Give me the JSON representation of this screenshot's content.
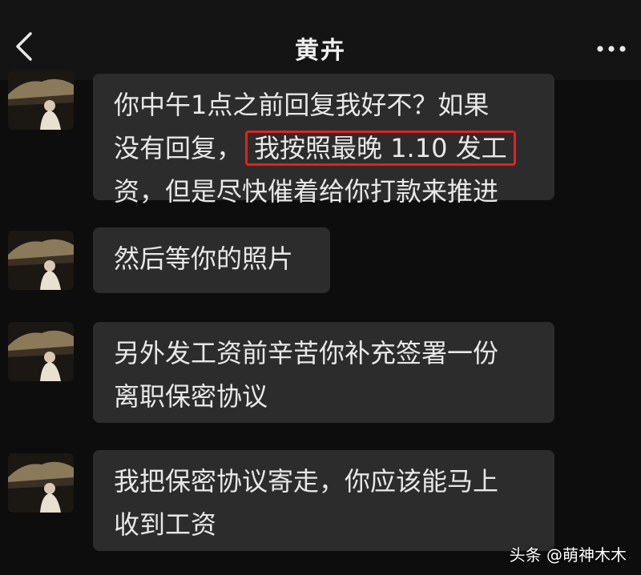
{
  "header": {
    "title": "黄卉",
    "back_icon": "chevron-left-icon",
    "more_icon": "ellipsis-icon"
  },
  "messages": [
    {
      "lines": [
        "你中午1点之前回复我好不？如果",
        "没有回复，",
        "资，但是尽快催着给你打款来推进"
      ],
      "highlight": "我按照最晚 1.10 发工"
    },
    {
      "lines": [
        "然后等你的照片"
      ]
    },
    {
      "lines": [
        "另外发工资前辛苦你补充签署一份",
        "离职保密协议"
      ]
    },
    {
      "lines": [
        "我把保密协议寄走，你应该能马上",
        "收到工资"
      ]
    }
  ],
  "watermark": "头条 @萌神木木",
  "colors": {
    "background": "#0d0d0d",
    "bubble": "#2c2c2c",
    "highlight_border": "#e0231f"
  }
}
